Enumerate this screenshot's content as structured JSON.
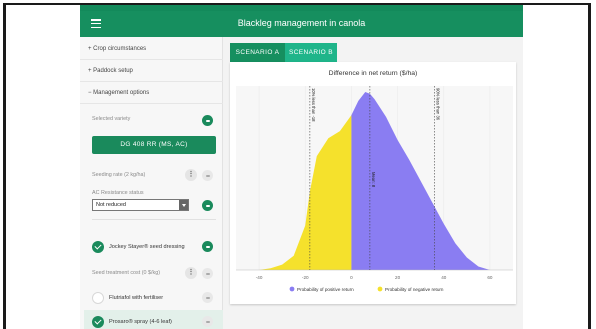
{
  "app": {
    "title": "Blackleg management in canola"
  },
  "sidebar": {
    "sections": [
      {
        "label": "+ Crop circumstances"
      },
      {
        "label": "+ Paddock setup"
      },
      {
        "label": "− Management options"
      }
    ],
    "selected_variety_label": "Selected variety",
    "variety_button": "DG 408 RR (MS, AC)",
    "seeding_rate_label": "Seeding rate (2 kg/ha)",
    "ac_resistance_label": "AC Resistance status",
    "ac_resistance_value": "Not reduced",
    "options": [
      {
        "label": "Jockey Stayer® seed dressing",
        "checked": true
      },
      {
        "label": "Seed treatment cost (0 $/kg)",
        "checked": null
      },
      {
        "label": "Flutriafol with fertiliser",
        "checked": false
      },
      {
        "label": "Prosaro® spray (4-6 leaf)",
        "checked": true
      }
    ]
  },
  "tabs": [
    {
      "label": "SCENARIO A",
      "active": false
    },
    {
      "label": "SCENARIO B",
      "active": true
    }
  ],
  "colors": {
    "accent": "#168f5f",
    "positive": "#8a7df2",
    "negative": "#f5e12c"
  },
  "chart_data": {
    "type": "area",
    "title": "Difference in net return ($/ha)",
    "xlim": [
      -50,
      70
    ],
    "x_ticks": [
      "-40",
      "-20",
      "0",
      "20",
      "40",
      "60"
    ],
    "annotations": [
      {
        "x": -18,
        "label": "10% less than -18"
      },
      {
        "x": 8,
        "label": "Mean: 8"
      },
      {
        "x": 36,
        "label": "90% less than 36"
      }
    ],
    "series": [
      {
        "name": "Probability of positive return",
        "color": "#8a7df2"
      },
      {
        "name": "Probability of negative return",
        "color": "#f5e12c"
      }
    ],
    "density": {
      "x": [
        -40,
        -35,
        -30,
        -25,
        -20,
        -18,
        -15,
        -10,
        -5,
        0,
        3,
        6,
        8,
        10,
        15,
        20,
        25,
        30,
        35,
        40,
        45,
        50,
        55,
        60
      ],
      "y": [
        0.0,
        0.01,
        0.03,
        0.08,
        0.25,
        0.44,
        0.64,
        0.74,
        0.78,
        0.87,
        0.95,
        1.0,
        0.99,
        0.96,
        0.86,
        0.73,
        0.62,
        0.5,
        0.38,
        0.26,
        0.15,
        0.07,
        0.02,
        0.0
      ]
    }
  }
}
